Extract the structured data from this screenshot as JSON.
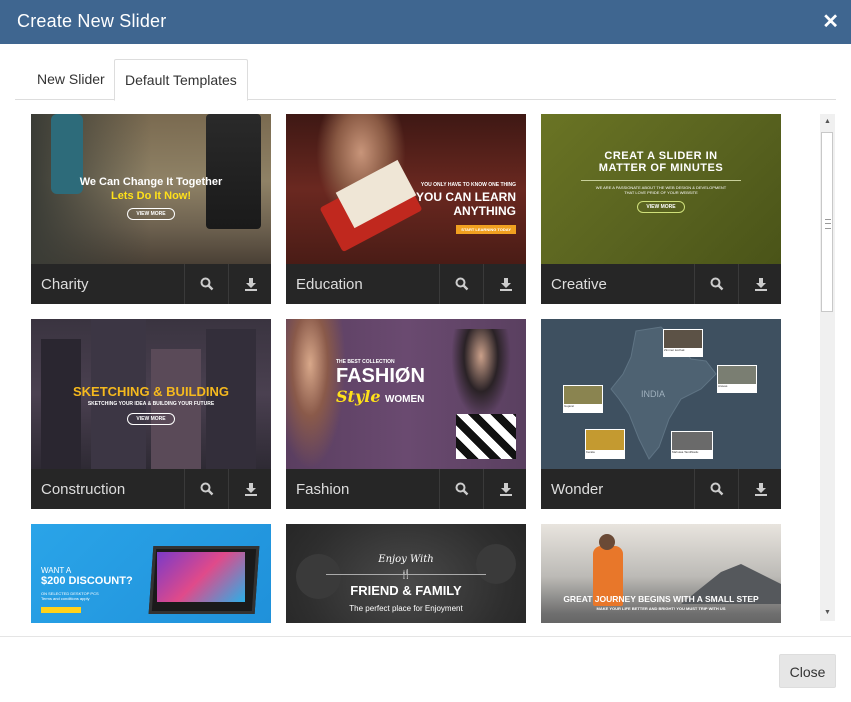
{
  "dialog": {
    "title": "Create New Slider"
  },
  "tabs": [
    {
      "label": "New Slider"
    },
    {
      "label": "Default Templates"
    }
  ],
  "templates": [
    {
      "name": "Charity",
      "line1": "We Can Change It Together",
      "line2": "Lets Do It Now!",
      "button": "VIEW MORE"
    },
    {
      "name": "Education",
      "line1": "YOU ONLY HAVE TO KNOW ONE THING",
      "line2": "YOU CAN LEARN",
      "line3": "ANYTHING",
      "button": "START LEARNING TODAY"
    },
    {
      "name": "Creative",
      "line1": "CREAT A SLIDER IN",
      "line2": "MATTER OF MINUTES",
      "line3": "WE ARE A PASSIONATE ABOUT THE WEB DESIGN & DEVELOPMENT",
      "line4": "THAT LOVE PRIDE OF YOUR WEBSITE",
      "button": "VIEW MORE"
    },
    {
      "name": "Construction",
      "line1": "SKETCHING & BUILDING",
      "line2": "SKETCHING YOUR IDEA & BUILDING YOUR FUTURE",
      "button": "VIEW MORE"
    },
    {
      "name": "Fashion",
      "line1": "THE BEST COLLECTION",
      "line2": "FASHIØN",
      "line3": "Style",
      "line4": "WOMEN"
    },
    {
      "name": "Wonder",
      "country": "INDIA",
      "places": [
        "Zimmer kochak",
        "Aravas",
        "Gujarat",
        "Kerala",
        "Mahuwa TamilNadu"
      ]
    },
    {
      "line1": "WANT A",
      "line2": "$200 DISCOUNT?",
      "line3": "ON SELECTED DESKTOP PCS",
      "line4": "Terms and conditions apply"
    },
    {
      "line1": "Enjoy With",
      "line2": "FRIEND & FAMILY",
      "line3": "The perfect place for Enjoyment"
    },
    {
      "line1": "GREAT JOURNEY BEGINS WITH A SMALL STEP",
      "line2": "MAKE YOUR LIFE BETTER AND BRIGHT! YOU MUST TRIP WITH US"
    }
  ],
  "footer": {
    "close_label": "Close"
  },
  "icons": {
    "close": "close-icon",
    "preview": "search-icon",
    "install": "download-icon"
  }
}
